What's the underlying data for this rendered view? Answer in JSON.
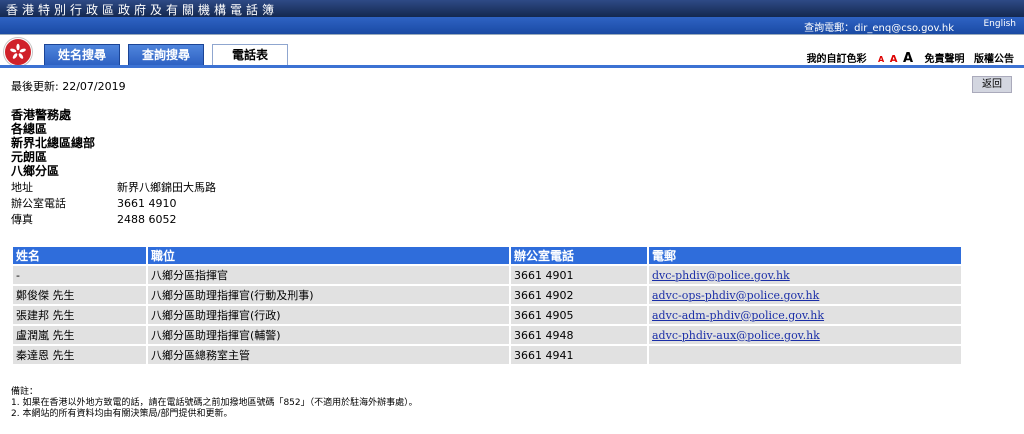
{
  "site_title": "香港特別行政區政府及有關機構電話簿",
  "header": {
    "inquiry": "查詢電郵：dir_enq@cso.gov.hk",
    "language_link": "English"
  },
  "tabs": [
    {
      "label": "姓名搜尋"
    },
    {
      "label": "查詢搜尋"
    },
    {
      "label": "電話表"
    }
  ],
  "toolbar": {
    "color_label": "我的自訂色彩",
    "font_small": "A",
    "font_medium": "A",
    "font_large": "A",
    "disclaimer": "免責聲明",
    "copyright": "版權公告"
  },
  "updated": "最後更新: 22/07/2019",
  "back_label": "返回",
  "org": [
    "香港警務處",
    "各總區",
    "新界北總區總部",
    "元朗區",
    "八鄉分區"
  ],
  "info": [
    {
      "label": "地址",
      "value": "新界八鄉錦田大馬路"
    },
    {
      "label": "辦公室電話",
      "value": "3661 4910"
    },
    {
      "label": "傳真",
      "value": "2488 6052"
    }
  ],
  "table": {
    "headers": [
      "姓名",
      "職位",
      "辦公室電話",
      "電郵"
    ],
    "rows": [
      [
        "-",
        "八鄉分區指揮官",
        "3661 4901",
        "dvc-phdiv@police.gov.hk"
      ],
      [
        "鄭俊傑 先生",
        "八鄉分區助理指揮官(行動及刑事)",
        "3661 4902",
        "advc-ops-phdiv@police.gov.hk"
      ],
      [
        "張建邦 先生",
        "八鄉分區助理指揮官(行政)",
        "3661 4905",
        "advc-adm-phdiv@police.gov.hk"
      ],
      [
        "盧潤嵐 先生",
        "八鄉分區助理指揮官(輔警)",
        "3661 4948",
        "advc-phdiv-aux@police.gov.hk"
      ],
      [
        "秦達恩 先生",
        "八鄉分區總務室主管",
        "3661 4941",
        ""
      ]
    ]
  },
  "notes": {
    "title": "備註：",
    "items": [
      "1.   如果在香港以外地方致電的話，請在電話號碼之前加撥地區號碼「852」（不適用於駐海外辦事處）。",
      "2.   本網站的所有資料均由有關決策局/部門提供和更新。"
    ]
  }
}
